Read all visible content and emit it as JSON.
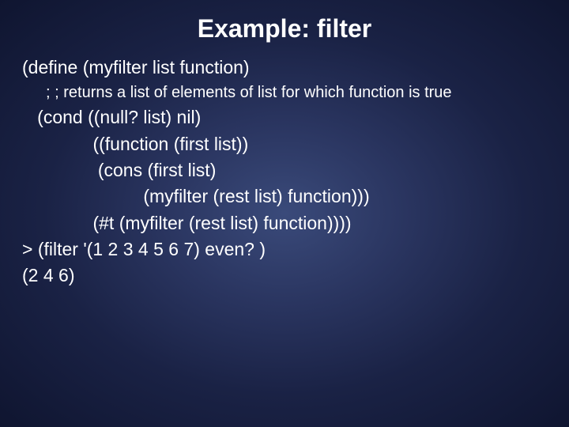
{
  "title": "Example: filter",
  "code": {
    "l1": "(define (myfilter list function)",
    "comment": "; ; returns a list of elements of list for which function is true",
    "l2": "   (cond ((null? list) nil)",
    "l3": "              ((function (first list))",
    "l4": "               (cons (first list)",
    "l5": "                        (myfilter (rest list) function)))",
    "l6": "              (#t (myfilter (rest list) function))))",
    "l7": "> (filter '(1 2 3 4 5 6 7) even? )",
    "l8": "(2 4 6)"
  }
}
